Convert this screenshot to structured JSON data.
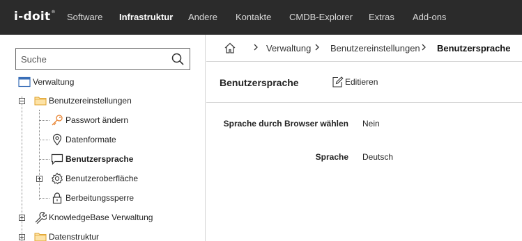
{
  "app": {
    "logo": "i-doit",
    "logo_mark": "®"
  },
  "topnav": {
    "items": [
      {
        "label": "Software",
        "active": false
      },
      {
        "label": "Infrastruktur",
        "active": true
      },
      {
        "label": "Andere",
        "active": false
      },
      {
        "label": "Kontakte",
        "active": false
      },
      {
        "label": "CMDB-Explorer",
        "active": false
      },
      {
        "label": "Extras",
        "active": false
      },
      {
        "label": "Add-ons",
        "active": false
      }
    ]
  },
  "sidebar": {
    "search": {
      "placeholder": "Suche",
      "value": ""
    },
    "tree": [
      {
        "label": "Verwaltung",
        "icon": "window-icon",
        "expander": "none"
      },
      {
        "label": "Benutzereinstellungen",
        "icon": "folder-icon",
        "expander": "minus"
      },
      {
        "label": "Passwort ändern",
        "icon": "key-icon",
        "expander": "none"
      },
      {
        "label": "Datenformate",
        "icon": "location-pin-icon",
        "expander": "none"
      },
      {
        "label": "Benutzersprache",
        "icon": "speech-bubble-icon",
        "expander": "none",
        "selected": true
      },
      {
        "label": "Benutzeroberfläche",
        "icon": "gear-icon",
        "expander": "plus"
      },
      {
        "label": "Berbeitungssperre",
        "icon": "lock-icon",
        "expander": "none"
      },
      {
        "label": "KnowledgeBase Verwaltung",
        "icon": "wrench-icon",
        "expander": "plus"
      },
      {
        "label": "Datenstruktur",
        "icon": "folder-icon",
        "expander": "plus"
      }
    ]
  },
  "breadcrumb": {
    "items": [
      "Verwaltung",
      "Benutzereinstellungen",
      "Benutzersprache"
    ]
  },
  "header": {
    "title": "Benutzersprache",
    "edit_label": "Editieren"
  },
  "fields": [
    {
      "label": "Sprache durch Browser wählen",
      "value": "Nein"
    },
    {
      "label": "Sprache",
      "value": "Deutsch"
    }
  ],
  "colors": {
    "topbar": "#2b2b2b",
    "folder": "#f4b942",
    "key": "#e8822f",
    "window": "#3a6fb8"
  }
}
